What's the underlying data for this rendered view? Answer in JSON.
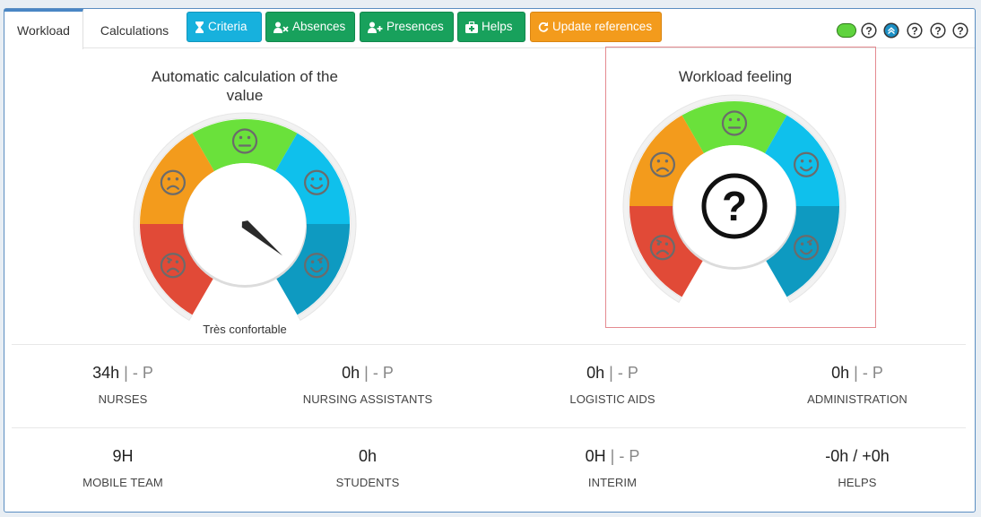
{
  "tabs": [
    {
      "label": "Workload",
      "active": true
    },
    {
      "label": "Calculations",
      "active": false
    }
  ],
  "toolbar": {
    "criteria": "Criteria",
    "absences": "Absences",
    "presences": "Presences",
    "helps": "Helps",
    "update_references": "Update references"
  },
  "colors": {
    "orange": "#f39b1c",
    "green": "#6ae13b",
    "cyan": "#0fc0ec",
    "blue": "#0e9ac1",
    "red": "#e14a37"
  },
  "gauges": {
    "auto": {
      "title": "Automatic calculation of the value",
      "caption": "Très confortable",
      "needle_level": "Très confortable"
    },
    "feeling": {
      "title": "Workload feeling",
      "center_symbol": "?"
    }
  },
  "stats": [
    {
      "value": "34h",
      "sep": "|",
      "rest": "- P",
      "label": "NURSES"
    },
    {
      "value": "0h",
      "sep": "|",
      "rest": "- P",
      "label": "NURSING ASSISTANTS"
    },
    {
      "value": "0h",
      "sep": "|",
      "rest": "- P",
      "label": "LOGISTIC AIDS"
    },
    {
      "value": "0h",
      "sep": "|",
      "rest": "- P",
      "label": "ADMINISTRATION"
    },
    {
      "value": "9H",
      "sep": "",
      "rest": "",
      "label": "MOBILE TEAM"
    },
    {
      "value": "0h",
      "sep": "",
      "rest": "",
      "label": "STUDENTS"
    },
    {
      "value": "0H",
      "sep": "|",
      "rest": "- P",
      "label": "INTERIM"
    },
    {
      "value": "-0h / +0h",
      "sep": "",
      "rest": "",
      "label": "HELPS"
    }
  ]
}
